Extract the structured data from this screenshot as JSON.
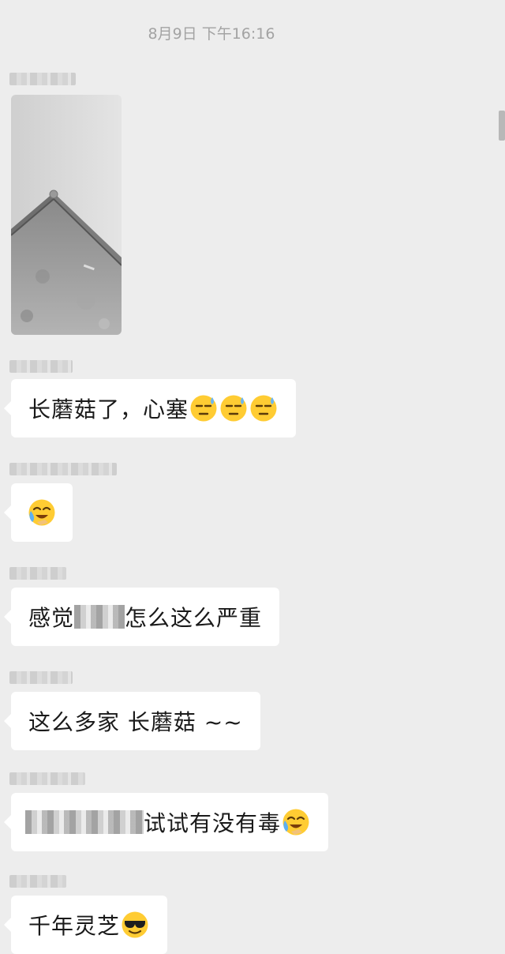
{
  "chat": {
    "timestamp": "8月9日 下午16:16",
    "messages": [
      {
        "type": "image",
        "alt": "photo of a floor corner"
      },
      {
        "type": "text",
        "text": "长蘑菇了，心塞",
        "emoji": [
          "downcast-sweat-emoji",
          "downcast-sweat-emoji",
          "downcast-sweat-emoji"
        ]
      },
      {
        "type": "emoji-only",
        "emoji": [
          "crying-laughing-emoji"
        ]
      },
      {
        "type": "text",
        "text_before": "感觉",
        "text_after": "怎么这么严重"
      },
      {
        "type": "text",
        "text": "这么多家 长蘑菇 ~~"
      },
      {
        "type": "text",
        "text": "试试有没有毒",
        "emoji": [
          "crying-laughing-emoji"
        ]
      },
      {
        "type": "text",
        "text": "千年灵芝",
        "emoji": [
          "sunglasses-emoji"
        ]
      }
    ]
  }
}
